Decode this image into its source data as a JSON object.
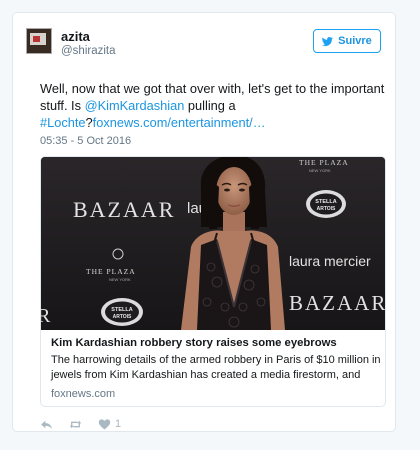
{
  "tweet": {
    "display_name": "azita",
    "handle": "@shirazita",
    "follow_label": "Suivre",
    "text_part1": "Well, now that we got that over with, let's get to the important stuff. Is ",
    "mention": "@KimKardashian",
    "text_part2": " pulling a ",
    "hashtag": "#Lochte",
    "text_part3": "?",
    "url": "foxnews.com/entertainment/…",
    "timestamp": "05:35 - 5 Oct 2016",
    "like_count": "1"
  },
  "card": {
    "title": "Kim Kardashian robbery story raises some eyebrows",
    "description": "The harrowing details of the armed robbery in Paris of $10 million in jewels from Kim Kardashian has created a media firestorm, and",
    "domain": "foxnews.com",
    "photo_texts": {
      "plaza_top": "THE PLAZA",
      "plaza_top_sub": "NEW YORK",
      "bazaar_top": "BAZAAR",
      "laura_partial": "lau",
      "er_partial": "er",
      "stella": "STELLA",
      "artois": "ARTOIS",
      "plaza_mid": "THE PLAZA",
      "plaza_mid_sub": "NEW YORK",
      "laura_mercier": "laura mercier",
      "bazaar_bottom": "BAZAAR",
      "r_partial": "R"
    }
  },
  "icons": {
    "follow": "twitter-bird-icon",
    "reply": "reply-icon",
    "retweet": "retweet-icon",
    "like": "heart-icon"
  },
  "colors": {
    "link": "#1b95e0",
    "follow_border": "#1da1f2",
    "muted": "#657786",
    "action": "#aab8c2"
  }
}
